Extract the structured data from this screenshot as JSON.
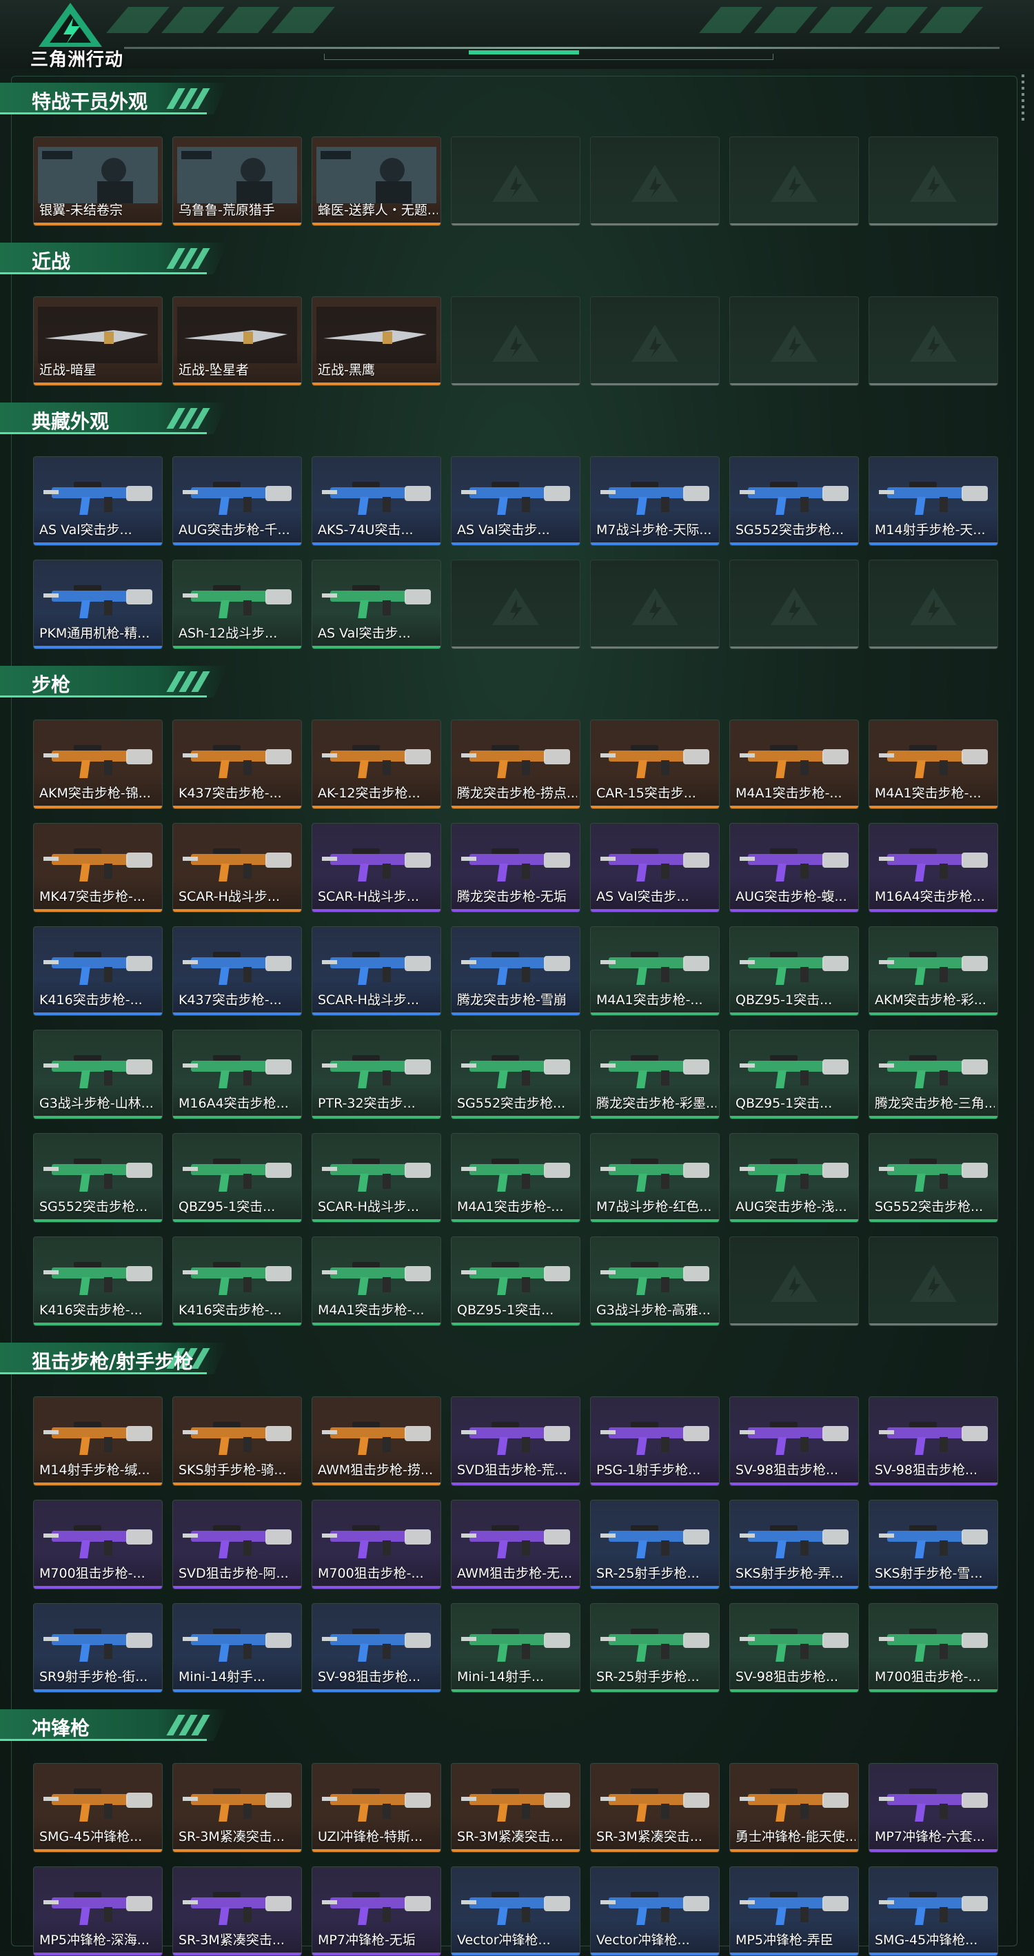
{
  "app": {
    "logo_text": "三角洲行动"
  },
  "sections": [
    {
      "title": "特战干员外观",
      "rows": [
        [
          [
            "银翼-未结卷宗",
            "orange",
            "banner"
          ],
          [
            "乌鲁鲁-荒原猎手",
            "orange",
            "banner"
          ],
          [
            "蜂医-送葬人・无题...",
            "orange",
            "banner"
          ],
          [
            null,
            "empty"
          ],
          [
            null,
            "empty"
          ],
          [
            null,
            "empty"
          ],
          [
            null,
            "empty"
          ]
        ]
      ]
    },
    {
      "title": "近战",
      "rows": [
        [
          [
            "近战-暗星",
            "orange",
            "knife"
          ],
          [
            "近战-坠星者",
            "orange",
            "knife"
          ],
          [
            "近战-黑鹰",
            "orange",
            "knife"
          ],
          [
            null,
            "empty"
          ],
          [
            null,
            "empty"
          ],
          [
            null,
            "empty"
          ],
          [
            null,
            "empty"
          ]
        ]
      ]
    },
    {
      "title": "典藏外观",
      "rows": [
        [
          [
            "AS Val突击步...",
            "blue",
            "gun"
          ],
          [
            "AUG突击步枪-千...",
            "blue",
            "gun"
          ],
          [
            "AKS-74U突击...",
            "blue",
            "gun"
          ],
          [
            "AS Val突击步...",
            "blue",
            "gun"
          ],
          [
            "M7战斗步枪-天际...",
            "blue",
            "gun"
          ],
          [
            "SG552突击步枪...",
            "blue",
            "gun"
          ],
          [
            "M14射手步枪-天...",
            "blue",
            "gun"
          ]
        ],
        [
          [
            "PKM通用机枪-精...",
            "blue",
            "gun"
          ],
          [
            "ASh-12战斗步...",
            "green",
            "gun"
          ],
          [
            "AS Val突击步...",
            "green",
            "gun"
          ],
          [
            null,
            "empty"
          ],
          [
            null,
            "empty"
          ],
          [
            null,
            "empty"
          ],
          [
            null,
            "empty"
          ]
        ]
      ]
    },
    {
      "title": "步枪",
      "rows": [
        [
          [
            "AKM突击步枪-锦...",
            "orange",
            "gun"
          ],
          [
            "K437突击步枪-...",
            "orange",
            "gun"
          ],
          [
            "AK-12突击步枪...",
            "orange",
            "gun"
          ],
          [
            "腾龙突击步枪-捞点...",
            "orange",
            "gun"
          ],
          [
            "CAR-15突击步...",
            "orange",
            "gun"
          ],
          [
            "M4A1突击步枪-...",
            "orange",
            "gun"
          ],
          [
            "M4A1突击步枪-...",
            "orange",
            "gun"
          ]
        ],
        [
          [
            "MK47突击步枪-...",
            "orange",
            "gun"
          ],
          [
            "SCAR-H战斗步...",
            "orange",
            "gun"
          ],
          [
            "SCAR-H战斗步...",
            "purple",
            "gun"
          ],
          [
            "腾龙突击步枪-无垢",
            "purple",
            "gun"
          ],
          [
            "AS Val突击步...",
            "purple",
            "gun"
          ],
          [
            "AUG突击步枪-蝮...",
            "purple",
            "gun"
          ],
          [
            "M16A4突击步枪...",
            "purple",
            "gun"
          ]
        ],
        [
          [
            "K416突击步枪-...",
            "blue",
            "gun"
          ],
          [
            "K437突击步枪-...",
            "blue",
            "gun"
          ],
          [
            "SCAR-H战斗步...",
            "blue",
            "gun"
          ],
          [
            "腾龙突击步枪-雪崩",
            "blue",
            "gun"
          ],
          [
            "M4A1突击步枪-...",
            "green",
            "gun"
          ],
          [
            "QBZ95-1突击...",
            "green",
            "gun"
          ],
          [
            "AKM突击步枪-彩...",
            "green",
            "gun"
          ]
        ],
        [
          [
            "G3战斗步枪-山林...",
            "green",
            "gun"
          ],
          [
            "M16A4突击步枪...",
            "green",
            "gun"
          ],
          [
            "PTR-32突击步...",
            "green",
            "gun"
          ],
          [
            "SG552突击步枪...",
            "green",
            "gun"
          ],
          [
            "腾龙突击步枪-彩墨...",
            "green",
            "gun"
          ],
          [
            "QBZ95-1突击...",
            "green",
            "gun"
          ],
          [
            "腾龙突击步枪-三角...",
            "green",
            "gun"
          ]
        ],
        [
          [
            "SG552突击步枪...",
            "green",
            "gun"
          ],
          [
            "QBZ95-1突击...",
            "green",
            "gun"
          ],
          [
            "SCAR-H战斗步...",
            "green",
            "gun"
          ],
          [
            "M4A1突击步枪-...",
            "green",
            "gun"
          ],
          [
            "M7战斗步枪-红色...",
            "green",
            "gun"
          ],
          [
            "AUG突击步枪-浅...",
            "green",
            "gun"
          ],
          [
            "SG552突击步枪...",
            "green",
            "gun"
          ]
        ],
        [
          [
            "K416突击步枪-...",
            "green",
            "gun"
          ],
          [
            "K416突击步枪-...",
            "green",
            "gun"
          ],
          [
            "M4A1突击步枪-...",
            "green",
            "gun"
          ],
          [
            "QBZ95-1突击...",
            "green",
            "gun"
          ],
          [
            "G3战斗步枪-高雅...",
            "green",
            "gun"
          ],
          [
            null,
            "empty"
          ],
          [
            null,
            "empty"
          ]
        ]
      ]
    },
    {
      "title": "狙击步枪/射手步枪",
      "rows": [
        [
          [
            "M14射手步枪-缄...",
            "orange",
            "gun"
          ],
          [
            "SKS射手步枪-骑...",
            "orange",
            "gun"
          ],
          [
            "AWM狙击步枪-捞...",
            "orange",
            "gun"
          ],
          [
            "SVD狙击步枪-荒...",
            "purple",
            "gun"
          ],
          [
            "PSG-1射手步枪...",
            "purple",
            "gun"
          ],
          [
            "SV-98狙击步枪...",
            "purple",
            "gun"
          ],
          [
            "SV-98狙击步枪...",
            "purple",
            "gun"
          ]
        ],
        [
          [
            "M700狙击步枪-...",
            "purple",
            "gun"
          ],
          [
            "SVD狙击步枪-阿...",
            "purple",
            "gun"
          ],
          [
            "M700狙击步枪-...",
            "purple",
            "gun"
          ],
          [
            "AWM狙击步枪-无...",
            "purple",
            "gun"
          ],
          [
            "SR-25射手步枪...",
            "blue",
            "gun"
          ],
          [
            "SKS射手步枪-弄...",
            "blue",
            "gun"
          ],
          [
            "SKS射手步枪-雪...",
            "blue",
            "gun"
          ]
        ],
        [
          [
            "SR9射手步枪-街...",
            "blue",
            "gun"
          ],
          [
            "Mini-14射手...",
            "blue",
            "gun"
          ],
          [
            "SV-98狙击步枪...",
            "blue",
            "gun"
          ],
          [
            "Mini-14射手...",
            "green",
            "gun"
          ],
          [
            "SR-25射手步枪...",
            "green",
            "gun"
          ],
          [
            "SV-98狙击步枪...",
            "green",
            "gun"
          ],
          [
            "M700狙击步枪-...",
            "green",
            "gun"
          ]
        ]
      ]
    },
    {
      "title": "冲锋枪",
      "rows": [
        [
          [
            "SMG-45冲锋枪...",
            "orange",
            "gun"
          ],
          [
            "SR-3M紧凑突击...",
            "orange",
            "gun"
          ],
          [
            "UZI冲锋枪-特斯...",
            "orange",
            "gun"
          ],
          [
            "SR-3M紧凑突击...",
            "orange",
            "gun"
          ],
          [
            "SR-3M紧凑突击...",
            "orange",
            "gun"
          ],
          [
            "勇士冲锋枪-能天使...",
            "orange",
            "gun"
          ],
          [
            "MP7冲锋枪-六套...",
            "purple",
            "gun"
          ]
        ],
        [
          [
            "MP5冲锋枪-深海...",
            "purple",
            "gun"
          ],
          [
            "SR-3M紧凑突击...",
            "purple",
            "gun"
          ],
          [
            "MP7冲锋枪-无垢",
            "purple",
            "gun"
          ],
          [
            "Vector冲锋枪...",
            "blue",
            "gun"
          ],
          [
            "Vector冲锋枪...",
            "blue",
            "gun"
          ],
          [
            "MP5冲锋枪-弄臣",
            "blue",
            "gun"
          ],
          [
            "SMG-45冲锋枪...",
            "blue",
            "gun"
          ]
        ]
      ]
    }
  ],
  "colors": {
    "orange": "#e38a2b",
    "purple": "#8a53e8",
    "blue": "#3e86ea",
    "green": "#3cb873",
    "accent": "#57e0a0"
  }
}
